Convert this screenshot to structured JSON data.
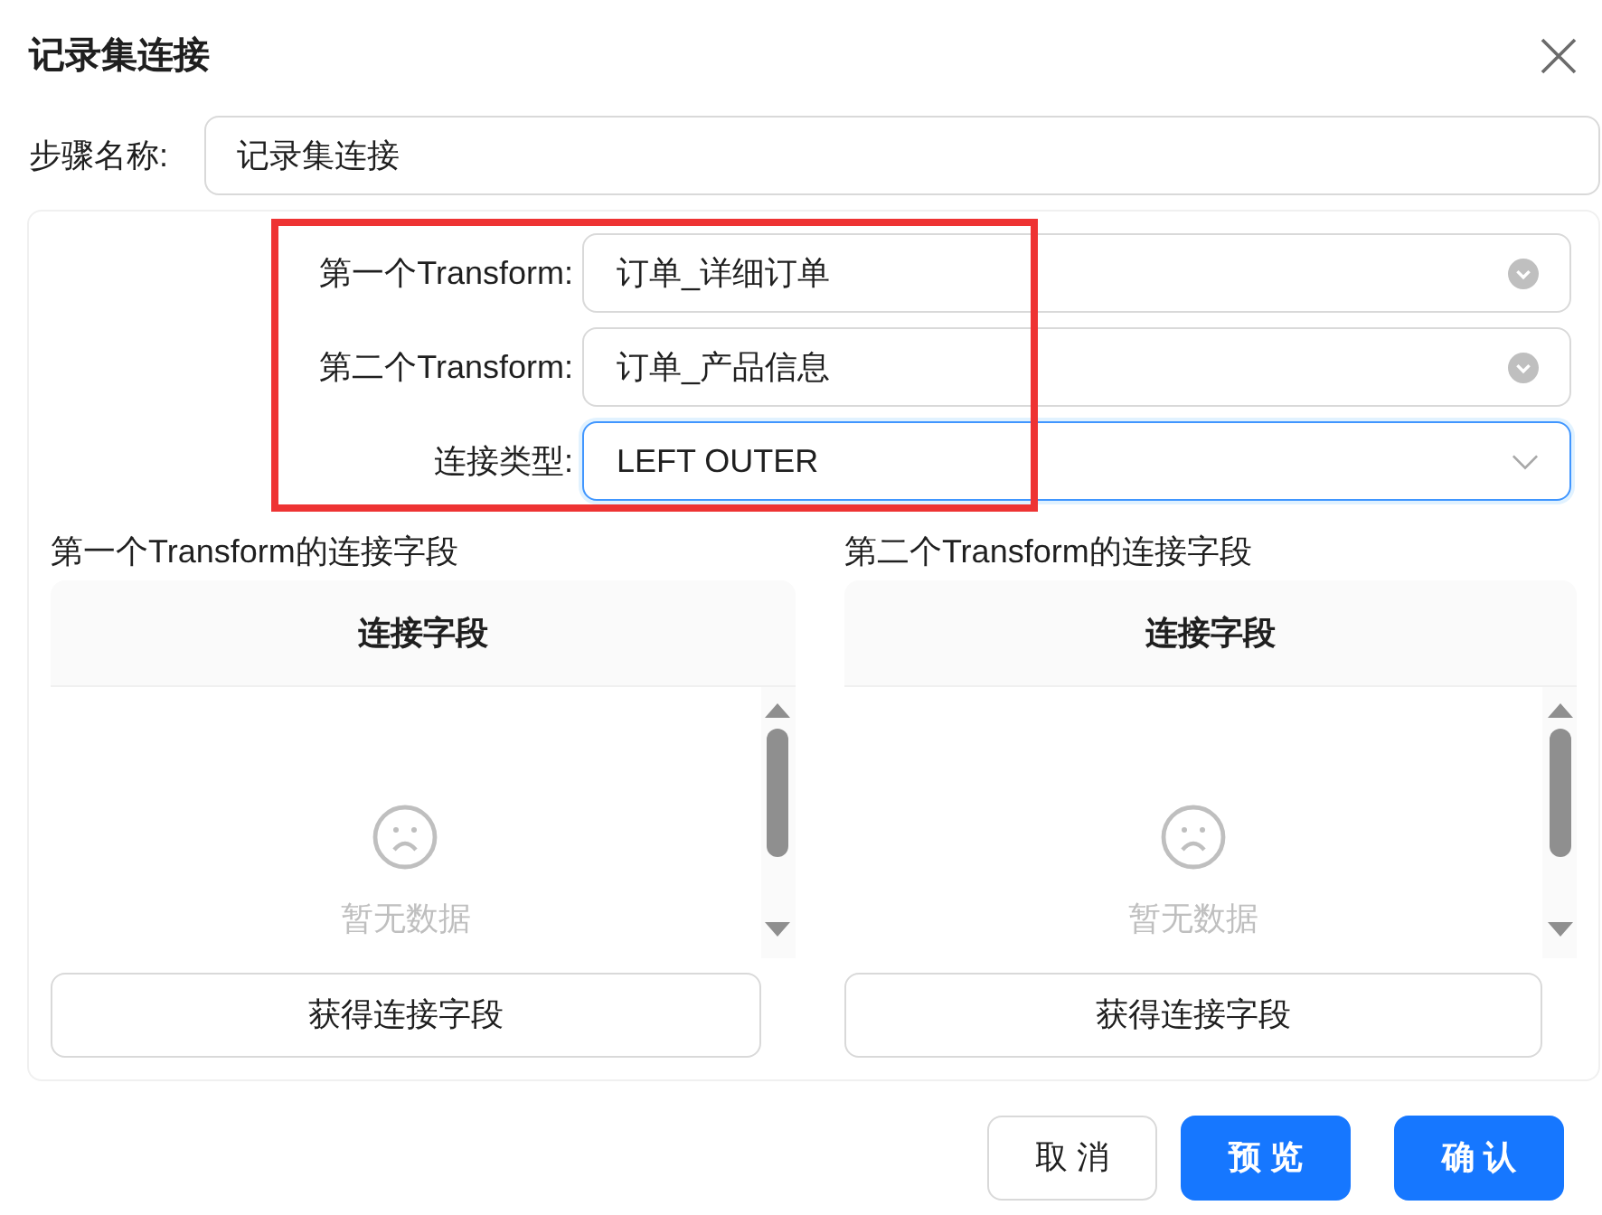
{
  "dialog": {
    "title": "记录集连接"
  },
  "step_name": {
    "label": "步骤名称:",
    "value": "记录集连接"
  },
  "form": {
    "highlighted": true,
    "fields": [
      {
        "label": "第一个Transform:",
        "value": "订单_详细订单",
        "focused": false
      },
      {
        "label": "第二个Transform:",
        "value": "订单_产品信息",
        "focused": false
      },
      {
        "label": "连接类型:",
        "value": "LEFT OUTER",
        "focused": true
      }
    ]
  },
  "field_lists": [
    {
      "title": "第一个Transform的连接字段",
      "table": {
        "columns": [
          "连接字段"
        ],
        "empty_text": "暂无数据"
      },
      "button": "获得连接字段"
    },
    {
      "title": "第二个Transform的连接字段",
      "table": {
        "columns": [
          "连接字段"
        ],
        "empty_text": "暂无数据"
      },
      "button": "获得连接字段"
    }
  ],
  "footer_buttons": [
    {
      "label": "取 消",
      "kind": "default"
    },
    {
      "label": "预 览",
      "kind": "primary"
    },
    {
      "label": "确 认",
      "kind": "primary"
    }
  ]
}
